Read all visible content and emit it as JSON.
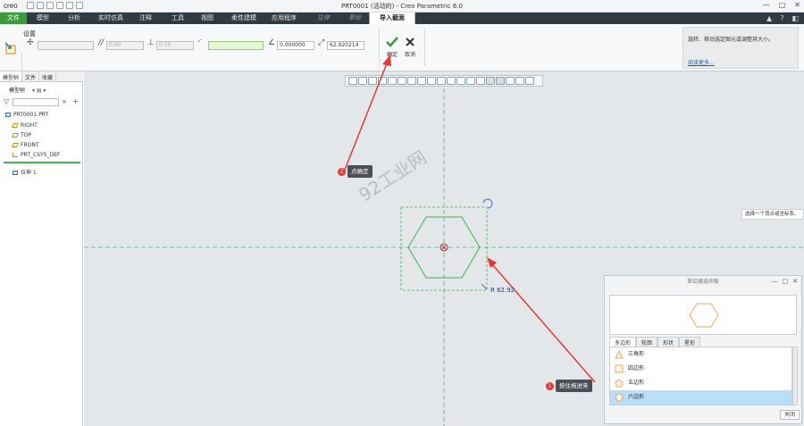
{
  "window": {
    "logo": "creo",
    "title": "PRT0001 (活动的) - Creo Parametric 6.0",
    "controls": [
      "—",
      "□",
      "✕"
    ]
  },
  "menu": {
    "file": "文件",
    "items": [
      "模型",
      "分析",
      "实时仿真",
      "注释",
      "工具",
      "视图",
      "柔性建模",
      "应用程序"
    ],
    "disabled": [
      "拉伸",
      "草绘"
    ],
    "active": "导入截面",
    "right_icons": [
      "▲",
      "?",
      "◧"
    ]
  },
  "ribbon": {
    "settings_label": "设置",
    "fields": {
      "field1": "",
      "field2": "0.00",
      "field3": "0.00",
      "field4": "",
      "angle": "0.000000",
      "scale": "62.920214"
    },
    "ok_label": "确定",
    "cancel_label": "取消",
    "help_text": "旋转、移动选定图元或调整其大小。",
    "help_link": "阅读更多..."
  },
  "sidebar": {
    "tabs": [
      "模型树",
      "文件",
      "收藏"
    ],
    "tree_label": "模型树",
    "items": [
      {
        "label": "PRT0001.PRT",
        "icon": "part"
      },
      {
        "label": "RIGHT",
        "icon": "plane"
      },
      {
        "label": "TOP",
        "icon": "plane"
      },
      {
        "label": "FRONT",
        "icon": "plane"
      },
      {
        "label": "PRT_CSYS_DEF",
        "icon": "csys"
      },
      {
        "label": "拉伸 1",
        "icon": "feature"
      }
    ]
  },
  "canvas": {
    "watermark": "92工业网",
    "radius_label": "R 62.92",
    "hint": "选择一个顶点或坐标系。",
    "callout_ok": {
      "num": "2",
      "text": "点确定"
    },
    "callout_drag": {
      "num": "1",
      "text": "按住拖进来"
    },
    "colors": {
      "shape": "#43b049",
      "axis": "#3fb59a",
      "arrow": "#e53935"
    }
  },
  "palette": {
    "title": "草绘器选项板",
    "tabs": [
      "多边形",
      "轮廓",
      "形状",
      "星形"
    ],
    "items": [
      "三角形",
      "四边形",
      "五边形",
      "六边形"
    ],
    "selected": "六边形",
    "close_label": "关闭"
  }
}
